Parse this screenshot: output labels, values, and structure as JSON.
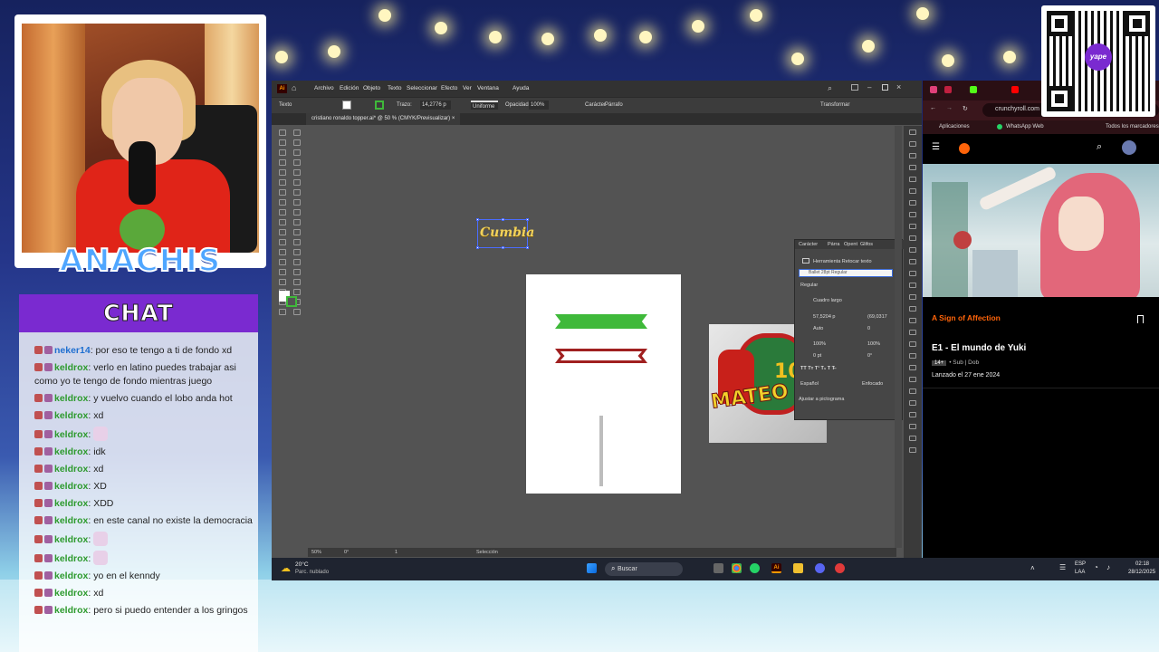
{
  "streamer": {
    "name": "ANACHIS"
  },
  "chat": {
    "title": "CHAT",
    "messages": [
      {
        "user": "neker14",
        "color": "#1f6fd0",
        "text": ": por eso te tengo a ti de fondo xd"
      },
      {
        "user": "keldrox",
        "color": "#2d9a2d",
        "text": ": verlo en latino puedes trabajar asi como yo te tengo de fondo mientras juego"
      },
      {
        "user": "keldrox",
        "color": "#2d9a2d",
        "text": ": y vuelvo cuando el lobo anda hot"
      },
      {
        "user": "keldrox",
        "color": "#2d9a2d",
        "text": ": xd"
      },
      {
        "user": "keldrox",
        "color": "#2d9a2d",
        "text": ":",
        "emote": true
      },
      {
        "user": "keldrox",
        "color": "#2d9a2d",
        "text": ": idk"
      },
      {
        "user": "keldrox",
        "color": "#2d9a2d",
        "text": ": xd"
      },
      {
        "user": "keldrox",
        "color": "#2d9a2d",
        "text": ": XD"
      },
      {
        "user": "keldrox",
        "color": "#2d9a2d",
        "text": ": XDD"
      },
      {
        "user": "keldrox",
        "color": "#2d9a2d",
        "text": ": en este canal no existe la democracia"
      },
      {
        "user": "keldrox",
        "color": "#2d9a2d",
        "text": ":",
        "emote": true
      },
      {
        "user": "keldrox",
        "color": "#2d9a2d",
        "text": ":",
        "emote": true
      },
      {
        "user": "keldrox",
        "color": "#2d9a2d",
        "text": ": yo en el kenndy"
      },
      {
        "user": "keldrox",
        "color": "#2d9a2d",
        "text": ": xd"
      },
      {
        "user": "keldrox",
        "color": "#2d9a2d",
        "text": ": pero si puedo entender a los gringos"
      }
    ]
  },
  "illustrator": {
    "logo": "Ai",
    "menu": [
      "Archivo",
      "Edición",
      "Objeto",
      "Texto",
      "Seleccionar",
      "Efecto",
      "Ver",
      "Ventana",
      "Ayuda"
    ],
    "control": {
      "tool_label": "Texto",
      "stroke_label": "Trazo:",
      "stroke_value": "14,2776 p",
      "stroke_style": "Uniforme",
      "opacity_label": "Opacidad:",
      "opacity_value": "100%",
      "char_label": "Carácter",
      "para_label": "Párrafo",
      "transform_label": "Transformar"
    },
    "doc_tab": "cristiano ronaldo topper.ai* @ 50 % (CMYK/Previsualizar)",
    "status": {
      "zoom": "50%",
      "rotation": "0°",
      "artboard": "1",
      "mode": "Selección"
    },
    "canvas_text": "Cumbia",
    "photo_text": {
      "number": "10",
      "name": "MATEO"
    },
    "character_panel": {
      "tabs": [
        "Carácter",
        "Párra",
        "Opent",
        "Glifos"
      ],
      "retouch": "Herramienta Retocar texto",
      "font": "Ballet 28pt Regular",
      "style": "Regular",
      "kerning_mode": "Cuadro largo",
      "size": "57,5204 p",
      "leading": "(69,0317",
      "tracking_auto": "Auto",
      "tracking_val": "0",
      "vscale": "100%",
      "hscale": "100%",
      "baseline": "0 pt",
      "rotate": "0°",
      "language": "Español",
      "aa": "Enfocado",
      "snap": "Ajustar a pictograma"
    }
  },
  "taskbar": {
    "weather_temp": "20°C",
    "weather_desc": "Parc. nublado",
    "search": "Buscar",
    "lang1": "ESP",
    "lang2": "LAA",
    "time": "02:18",
    "date": "28/12/2025"
  },
  "browser": {
    "url": "crunchyroll.com",
    "bookmarks": [
      "Aplicaciones",
      "WhatsApp Web",
      "Todos los marcadores"
    ],
    "show_title": "A Sign of Affection",
    "episode": "E1 - El mundo de Yuki",
    "rating": "14+",
    "meta": "• Sub | Dob",
    "release": "Lanzado el 27 ene 2024",
    "accent": "#ff640a"
  },
  "qr": {
    "label": "yape"
  }
}
